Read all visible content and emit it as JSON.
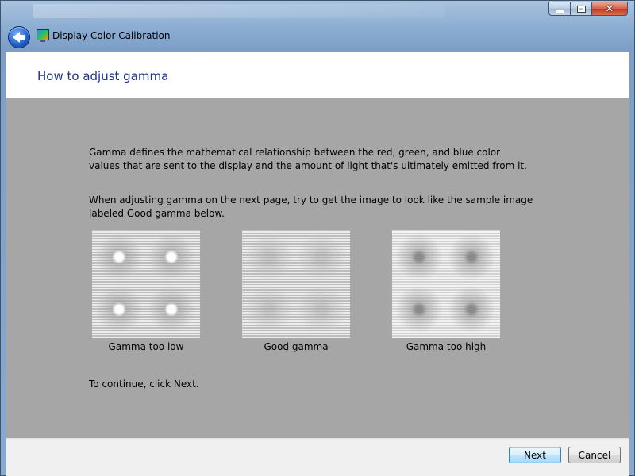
{
  "window": {
    "app_title": "Display Color Calibration",
    "controls": {
      "minimize_icon": "minimize-icon",
      "maximize_icon": "maximize-icon",
      "close_icon": "close-icon",
      "close_glyph": "✕"
    }
  },
  "header": {
    "title": "How to adjust gamma"
  },
  "body": {
    "paragraph1": "Gamma defines the mathematical relationship between the red, green, and blue color values that are sent to the display and the amount of light that's ultimately emitted from it.",
    "paragraph2": "When adjusting gamma on the next page, try to get the image to look like the sample image labeled Good gamma below.",
    "samples": [
      {
        "caption": "Gamma too low"
      },
      {
        "caption": "Good gamma"
      },
      {
        "caption": "Gamma too high"
      }
    ],
    "continue_text": "To continue, click Next."
  },
  "footer": {
    "next_label": "Next",
    "cancel_label": "Cancel"
  },
  "colors": {
    "header_title": "#1e3287",
    "panel_gray": "#a6a6a6",
    "footer_bg": "#f0f0f0"
  }
}
